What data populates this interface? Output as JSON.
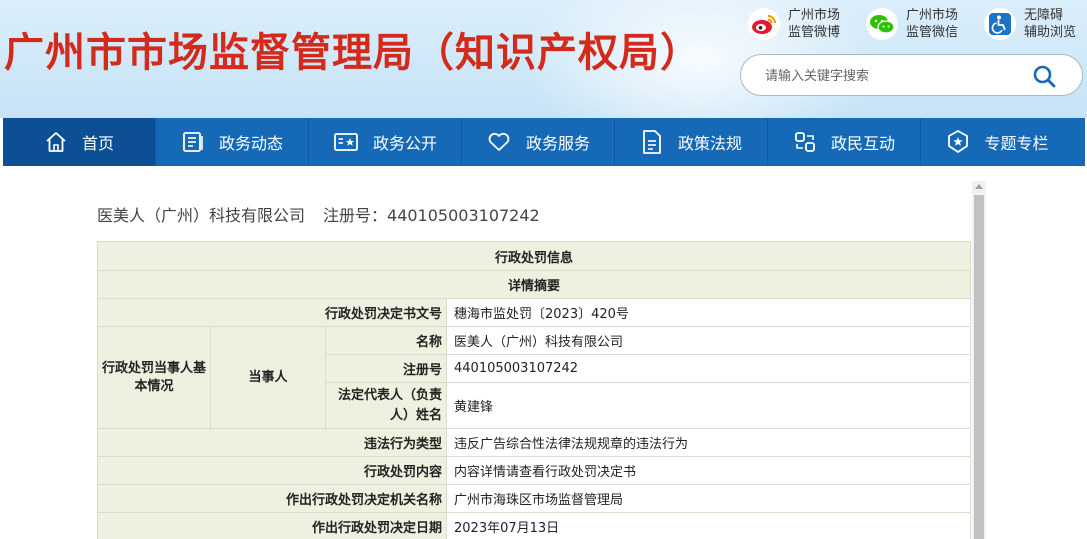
{
  "header": {
    "site_title": "广州市市场监督管理局（知识产权局）",
    "top_links": [
      {
        "icon": "weibo-icon",
        "line1": "广州市场",
        "line2": "监管微博"
      },
      {
        "icon": "wechat-icon",
        "line1": "广州市场",
        "line2": "监管微信"
      },
      {
        "icon": "accessibility-icon",
        "line1": "无障碍",
        "line2": "辅助浏览"
      }
    ],
    "search": {
      "placeholder": "请输入关键字搜索"
    }
  },
  "nav": {
    "items": [
      {
        "label": "首页",
        "icon": "home-icon"
      },
      {
        "label": "政务动态",
        "icon": "news-icon"
      },
      {
        "label": "政务公开",
        "icon": "open-affairs-icon"
      },
      {
        "label": "政务服务",
        "icon": "service-icon"
      },
      {
        "label": "政策法规",
        "icon": "document-icon"
      },
      {
        "label": "政民互动",
        "icon": "interaction-icon"
      },
      {
        "label": "专题专栏",
        "icon": "topic-icon"
      }
    ]
  },
  "company": {
    "name": "医美人（广州）科技有限公司",
    "reg_label": "注册号：440105003107242"
  },
  "table": {
    "title": "行政处罚信息",
    "subtitle": "详情摘要",
    "rows": {
      "doc_no_label": "行政处罚决定书文号",
      "doc_no_value": "穗海市监处罚〔2023〕420号",
      "party_group_label": "行政处罚当事人基本情况",
      "party_label": "当事人",
      "name_label": "名称",
      "name_value": "医美人（广州）科技有限公司",
      "reg_label": "注册号",
      "reg_value": "440105003107242",
      "rep_label": "法定代表人（负责人）姓名",
      "rep_value": "黄建锋",
      "violation_label": "违法行为类型",
      "violation_value": "违反广告综合性法律法规规章的违法行为",
      "content_label": "行政处罚内容",
      "content_value": "内容详情请查看行政处罚决定书",
      "authority_label": "作出行政处罚决定机关名称",
      "authority_value": "广州市海珠区市场监督管理局",
      "date_label": "作出行政处罚决定日期",
      "date_value": "2023年07月13日"
    }
  },
  "colors": {
    "title_red": "#d42a1b",
    "nav_blue": "#1669b7",
    "table_label_bg": "#f0f0e1"
  }
}
